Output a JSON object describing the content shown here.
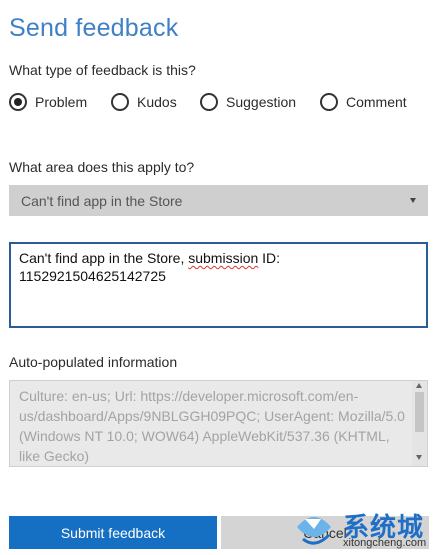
{
  "title": "Send feedback",
  "feedback_type": {
    "question": "What type of feedback is this?",
    "options": [
      "Problem",
      "Kudos",
      "Suggestion",
      "Comment"
    ],
    "selected": "Problem"
  },
  "area": {
    "question": "What area does this apply to?",
    "selected": "Can't find app in the Store"
  },
  "description": {
    "value_parts": [
      "Can't find app in the Store, ",
      "submission",
      " ID:\n1152921504625142725"
    ]
  },
  "auto_populated": {
    "label": "Auto-populated information",
    "text": "Culture: en-us; Url: https://developer.microsoft.com/en-us/dashboard/Apps/9NBLGGH09PQC; UserAgent: Mozilla/5.0 (Windows NT 10.0; WOW64) AppleWebKit/537.36 (KHTML, like Gecko)"
  },
  "buttons": {
    "submit": "Submit feedback",
    "cancel": "Cancel"
  },
  "watermark": {
    "text_cn": "系统城",
    "url": "xitongcheng.com",
    "colors": {
      "blue": "#1f6fc6",
      "light_blue": "#6cb3ea"
    }
  },
  "colors": {
    "title": "#3f80c6",
    "submit_bg": "#1570c4",
    "focus_border": "#2a5c9a"
  }
}
